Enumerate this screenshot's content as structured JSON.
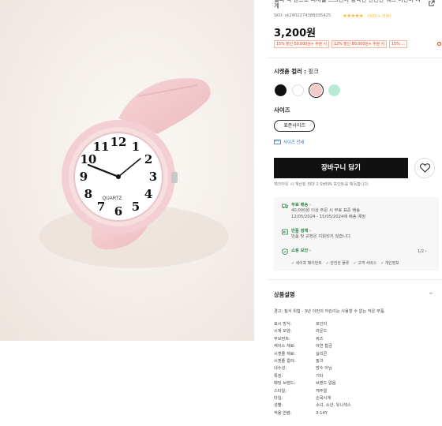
{
  "product": {
    "title": "젤리 색 밴드로 디지털 스크린이 장착된 간단한 쿼츠 어린이 시계",
    "sku": "SKU: sk2402274388035425",
    "stars": "★★★★★",
    "reviews": "(500+ 리뷰)",
    "price": "3,200원"
  },
  "coupons": [
    "15% 할인 50,000원+ 주문 시",
    "12% 할인 80,000원+ 주문 시",
    "15% ..."
  ],
  "color": {
    "label": "시켓쵿 컬러",
    "value": "핑크",
    "swatches": [
      {
        "name": "black",
        "color": "#111111"
      },
      {
        "name": "white",
        "color": "#ffffff"
      },
      {
        "name": "pink",
        "color": "#f2c8c9"
      },
      {
        "name": "mint",
        "color": "#b9ead6"
      }
    ]
  },
  "size": {
    "label": "사이즈",
    "option": "표준사이즈",
    "guide": "사이즈 안내"
  },
  "cart": {
    "button": "장바구니 담기",
    "points_note": "체크아웃 시 계산된 최대 2 SHEIN 포인트를 획득합니다."
  },
  "services": {
    "free_shipping_title": "무료 배송",
    "free_shipping_line1": "40,000원 이상 주문 시 무료 표준 배송",
    "free_shipping_line2": "12/05/2024 - 15/05/2024에 배송 예정",
    "return_title": "반품 정책",
    "return_line": "반품 및 교환은 지원되지 않습니다.",
    "security_title": "쇼핑 보안",
    "pager": "1/2",
    "chips": [
      "✓ 세이프 페이먼트",
      "✓ 안전한 물류",
      "✓ 고객 서비스",
      "✓ 개인정보"
    ]
  },
  "description": {
    "title": "상품설명",
    "warning": "경고: 질식 위험 - 3년 이먼의 어린이는 사용할 수 없는 작은 부품.",
    "specs": [
      {
        "k": "표시 방식:",
        "v": "포인터"
      },
      {
        "k": "시계 모양:",
        "v": "라운드"
      },
      {
        "k": "무브먼트:",
        "v": "쿼츠"
      },
      {
        "k": "케이스 재료:",
        "v": "아연 합금"
      },
      {
        "k": "시곗줄 재료:",
        "v": "실리콘"
      },
      {
        "k": "시곗줄 컬러:",
        "v": "핑크"
      },
      {
        "k": "내수성:",
        "v": "방수 아님"
      },
      {
        "k": "특징:",
        "v": "기타"
      },
      {
        "k": "패딩 브랜드:",
        "v": "브랜드 없음"
      },
      {
        "k": "스타일:",
        "v": "캐주얼"
      },
      {
        "k": "타입:",
        "v": "손목시계"
      },
      {
        "k": "성별:",
        "v": "소녀, 소년, 유니섹스"
      },
      {
        "k": "적용 연령:",
        "v": "3-14Y"
      }
    ]
  },
  "watch_face": {
    "numerals": [
      "12",
      "1",
      "2",
      "3",
      "4",
      "5",
      "6",
      "7",
      "8",
      "9",
      "10",
      "11"
    ],
    "brand": "QUARTZ"
  }
}
